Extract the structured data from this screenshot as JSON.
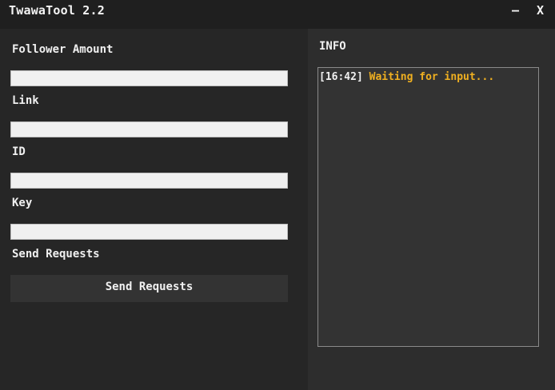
{
  "window": {
    "title": "TwawaTool 2.2",
    "minimize_label": "–",
    "close_label": "X"
  },
  "form": {
    "follower_amount_label": "Follower Amount",
    "follower_amount_value": "",
    "link_label": "Link",
    "link_value": "",
    "id_label": "ID",
    "id_value": "",
    "key_label": "Key",
    "key_value": "",
    "send_section_label": "Send Requests",
    "send_button_label": "Send Requests"
  },
  "info": {
    "title": "INFO",
    "log": [
      {
        "time": "[16:42]",
        "message": "Waiting for input..."
      }
    ]
  },
  "colors": {
    "background": "#262626",
    "panel": "#2d2d2d",
    "titlebar": "#1f1f1f",
    "accent_log": "#f0b020"
  }
}
